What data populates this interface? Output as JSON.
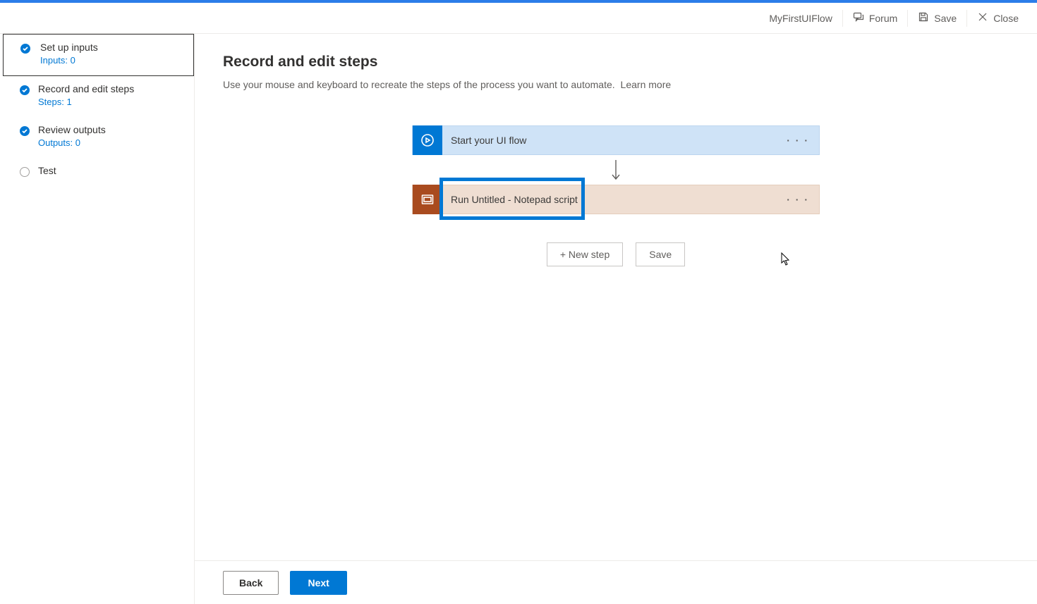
{
  "header": {
    "flowName": "MyFirstUIFlow",
    "forumLabel": "Forum",
    "saveLabel": "Save",
    "closeLabel": "Close"
  },
  "sidebar": {
    "steps": [
      {
        "title": "Set up inputs",
        "sub": "Inputs: 0",
        "done": true,
        "selected": true
      },
      {
        "title": "Record and edit steps",
        "sub": "Steps: 1",
        "done": true,
        "selected": false
      },
      {
        "title": "Review outputs",
        "sub": "Outputs: 0",
        "done": true,
        "selected": false
      },
      {
        "title": "Test",
        "sub": "",
        "done": false,
        "selected": false
      }
    ]
  },
  "main": {
    "title": "Record and edit steps",
    "description": "Use your mouse and keyboard to recreate the steps of the process you want to automate.",
    "learnMore": "Learn more",
    "card1Label": "Start your UI flow",
    "card2Label": "Run Untitled - Notepad script",
    "moreLabel": "· · ·",
    "newStepLabel": "+ New step",
    "saveLabel": "Save"
  },
  "footer": {
    "backLabel": "Back",
    "nextLabel": "Next"
  }
}
